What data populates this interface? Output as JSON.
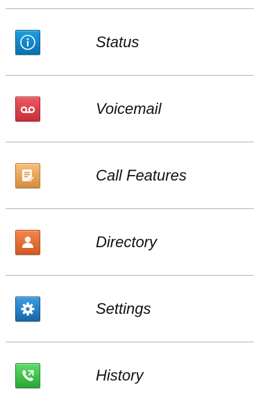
{
  "menu": {
    "items": [
      {
        "label": "Status",
        "icon": "info-icon",
        "color": "#1e9fe0",
        "color_dark": "#0b6fb0"
      },
      {
        "label": "Voicemail",
        "icon": "voicemail-icon",
        "color": "#e8474f",
        "color_dark": "#b5262d"
      },
      {
        "label": "Call Features",
        "icon": "call-features-icon",
        "color": "#f0b36a",
        "color_dark": "#cf8433"
      },
      {
        "label": "Directory",
        "icon": "contact-icon",
        "color": "#ef7a3a",
        "color_dark": "#c9521a"
      },
      {
        "label": "Settings",
        "icon": "gear-icon",
        "color": "#2e8fd6",
        "color_dark": "#15609f"
      },
      {
        "label": "History",
        "icon": "call-history-icon",
        "color": "#4fd059",
        "color_dark": "#23a02f"
      }
    ]
  }
}
